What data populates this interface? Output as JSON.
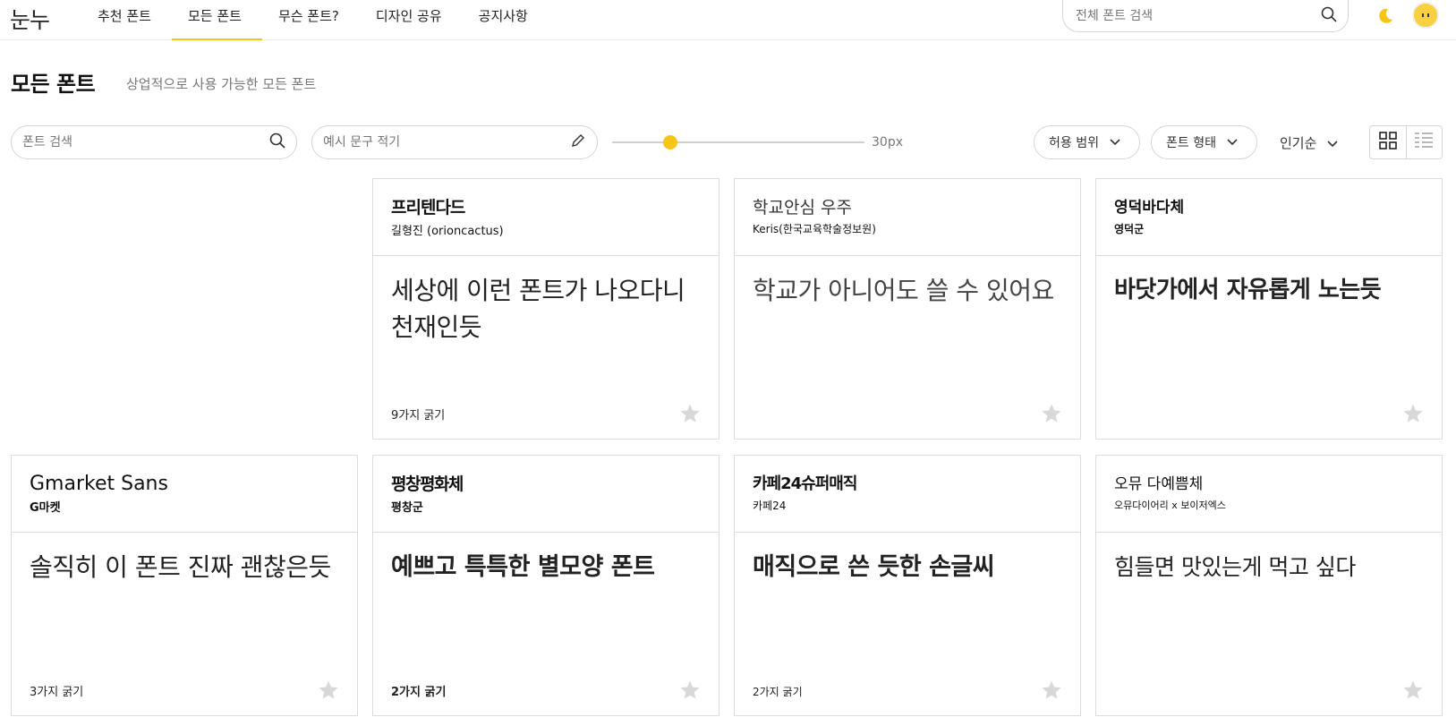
{
  "header": {
    "logo": "눈누",
    "nav": [
      {
        "label": "추천 폰트",
        "active": false
      },
      {
        "label": "모든 폰트",
        "active": true
      },
      {
        "label": "무슨 폰트?",
        "active": false
      },
      {
        "label": "디자인 공유",
        "active": false
      },
      {
        "label": "공지사항",
        "active": false
      }
    ],
    "search_placeholder": "전체 폰트 검색",
    "accent": "#f5c518"
  },
  "page": {
    "title": "모든 폰트",
    "subtitle": "상업적으로 사용 가능한 모든 폰트"
  },
  "controls": {
    "font_search_placeholder": "폰트 검색",
    "sample_placeholder": "예시 문구 적기",
    "size_value": "30px",
    "size_fraction": 0.23,
    "license_filter": "허용 범위",
    "type_filter": "폰트 형태",
    "sort": "인기순",
    "view_modes": [
      "grid",
      "list"
    ],
    "active_view": "grid"
  },
  "fonts": [
    {
      "name": "프리텐다드",
      "maker": "길형진 (orioncactus)",
      "sample": "세상에 이런 폰트가 나오다니 천재인듯",
      "weights": "9가지 굵기"
    },
    {
      "name": "학교안심 우주",
      "maker": "Keris(한국교육학술정보원)",
      "sample": "학교가 아니어도 쓸 수 있어요",
      "weights": ""
    },
    {
      "name": "영덕바다체",
      "maker": "영덕군",
      "sample": "바닷가에서 자유롭게 노는듯",
      "weights": ""
    },
    {
      "name": "Gmarket Sans",
      "maker": "G마켓",
      "sample": "솔직히 이 폰트 진짜 괜찮은듯",
      "weights": "3가지 굵기"
    },
    {
      "name": "평창평화체",
      "maker": "평창군",
      "sample": "예쁘고 특특한 별모양 폰트",
      "weights": "2가지 굵기"
    },
    {
      "name": "카페24슈퍼매직",
      "maker": "카페24",
      "sample": "매직으로 쓴 듯한 손글씨",
      "weights": "2가지 굵기"
    },
    {
      "name": "오뮤 다예쁨체",
      "maker": "오뮤다이어리 x 보이저엑스",
      "sample": "힘들면 맛있는게 먹고 싶다",
      "weights": ""
    }
  ]
}
